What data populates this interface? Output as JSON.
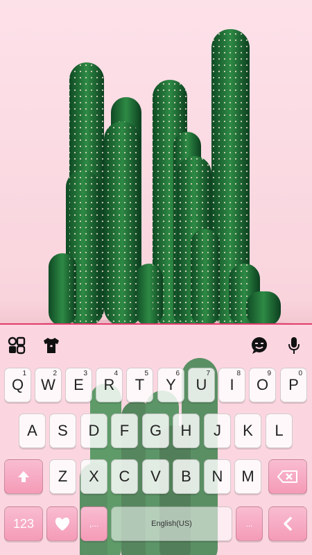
{
  "wallpaper": {
    "subject": "cactus-photo"
  },
  "toolbar": {
    "icons": [
      "apps-grid-icon",
      "theme-shirt-icon",
      "emoji-icon",
      "microphone-icon"
    ]
  },
  "keys": {
    "row1": [
      {
        "label": "Q",
        "hint": "1"
      },
      {
        "label": "W",
        "hint": "2"
      },
      {
        "label": "E",
        "hint": "3"
      },
      {
        "label": "R",
        "hint": "4"
      },
      {
        "label": "T",
        "hint": "5"
      },
      {
        "label": "Y",
        "hint": "6"
      },
      {
        "label": "U",
        "hint": "7"
      },
      {
        "label": "I",
        "hint": "8"
      },
      {
        "label": "O",
        "hint": "9"
      },
      {
        "label": "P",
        "hint": "0"
      }
    ],
    "row2": [
      "A",
      "S",
      "D",
      "F",
      "G",
      "H",
      "J",
      "K",
      "L"
    ],
    "row3": [
      "Z",
      "X",
      "C",
      "V",
      "B",
      "N",
      "M"
    ],
    "numbers_label": "123",
    "dots_left": ",...",
    "dots_right": "...",
    "space_label": "English(US)"
  },
  "colors": {
    "accent": "#e23a6b",
    "pink_key": "#f59bb8",
    "background": "#fbd6e0"
  }
}
